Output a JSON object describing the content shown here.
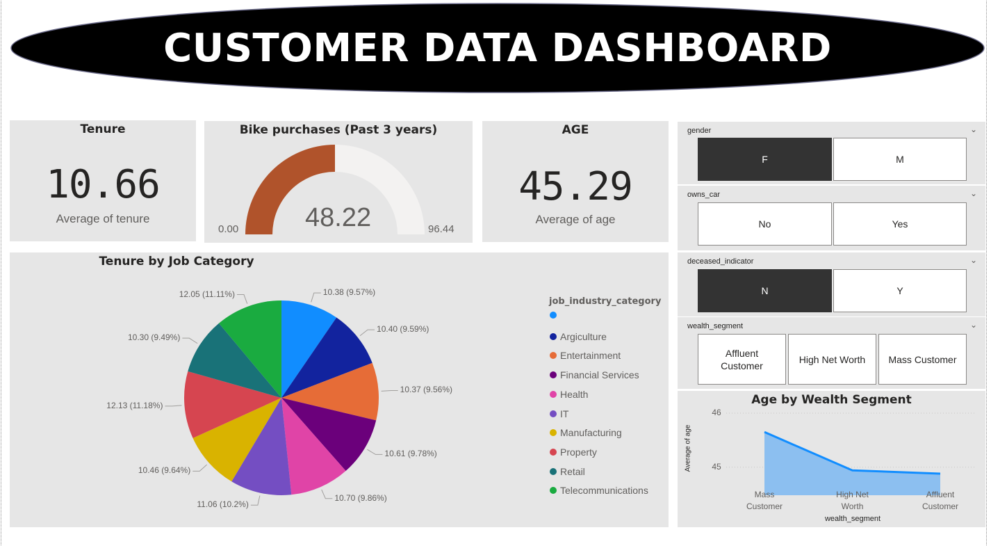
{
  "header": {
    "title": "CUSTOMER DATA DASHBOARD"
  },
  "kpis": {
    "tenure": {
      "title": "Tenure",
      "value": "10.66",
      "label": "Average of tenure"
    },
    "age": {
      "title": "AGE",
      "value": "45.29",
      "label": "Average of age"
    }
  },
  "gauge": {
    "title": "Bike purchases (Past 3 years)",
    "value_label": "48.22",
    "min_label": "0.00",
    "max_label": "96.44",
    "value": 48.22,
    "min": 0,
    "max": 96.44,
    "fill_color": "#b0532b",
    "track_color": "#f3f2f1"
  },
  "pie": {
    "title": "Tenure by Job Category",
    "legend_title": "job_industry_category",
    "legend": [
      {
        "label": "",
        "color": "#118dff"
      },
      {
        "label": "Argiculture",
        "color": "#12239e"
      },
      {
        "label": "Entertainment",
        "color": "#e66c37"
      },
      {
        "label": "Financial Services",
        "color": "#6b007b"
      },
      {
        "label": "Health",
        "color": "#e044a7"
      },
      {
        "label": "IT",
        "color": "#744ec2"
      },
      {
        "label": "Manufacturing",
        "color": "#d9b300"
      },
      {
        "label": "Property",
        "color": "#d64550"
      },
      {
        "label": "Retail",
        "color": "#197278"
      },
      {
        "label": "Telecommunications",
        "color": "#1aab40"
      }
    ]
  },
  "slicers": {
    "gender": {
      "label": "gender",
      "options": [
        "F",
        "M"
      ],
      "selected": "F"
    },
    "owns_car": {
      "label": "owns_car",
      "options": [
        "No",
        "Yes"
      ],
      "selected": ""
    },
    "deceased_indicator": {
      "label": "deceased_indicator",
      "options": [
        "N",
        "Y"
      ],
      "selected": "N"
    },
    "wealth_segment": {
      "label": "wealth_segment",
      "options": [
        "Affluent Customer",
        "High Net Worth",
        "Mass Customer"
      ],
      "selected": ""
    }
  },
  "icons": {
    "chevron": "chevron-down-icon"
  },
  "chart_data": [
    {
      "type": "pie",
      "title": "Tenure by Job Category",
      "legend_title": "job_industry_category",
      "categories": [
        "",
        "Argiculture",
        "Entertainment",
        "Financial Services",
        "Health",
        "IT",
        "Manufacturing",
        "Property",
        "Retail",
        "Telecommunications"
      ],
      "values": [
        10.38,
        10.4,
        10.37,
        10.61,
        10.7,
        11.06,
        10.46,
        12.13,
        10.3,
        12.05
      ],
      "labels": [
        "10.38 (9.57%)",
        "10.40 (9.59%)",
        "10.37 (9.56%)",
        "10.61 (9.78%)",
        "10.70 (9.86%)",
        "11.06 (10.2%)",
        "10.46 (9.64%)",
        "12.13 (11.18%)",
        "10.30 (9.49%)",
        "12.05 (11.11%)"
      ],
      "colors": [
        "#118dff",
        "#12239e",
        "#e66c37",
        "#6b007b",
        "#e044a7",
        "#744ec2",
        "#d9b300",
        "#d64550",
        "#197278",
        "#1aab40"
      ],
      "legend": "right"
    },
    {
      "type": "area",
      "title": "Age by Wealth Segment",
      "xlabel": "wealth_segment",
      "ylabel": "Average of age",
      "categories": [
        "Mass Customer",
        "High Net Worth",
        "Affluent Customer"
      ],
      "category_lines": [
        [
          "Mass",
          "Customer"
        ],
        [
          "High Net",
          "Worth"
        ],
        [
          "Affluent",
          "Customer"
        ]
      ],
      "values": [
        45.65,
        44.94,
        44.88
      ],
      "y_ticks": [
        "46",
        "45"
      ],
      "ylim": [
        44.48,
        46.18
      ],
      "baseline": 44.48,
      "grid": true,
      "line_color": "#118dff",
      "fill_color": "#8cbff0"
    }
  ]
}
